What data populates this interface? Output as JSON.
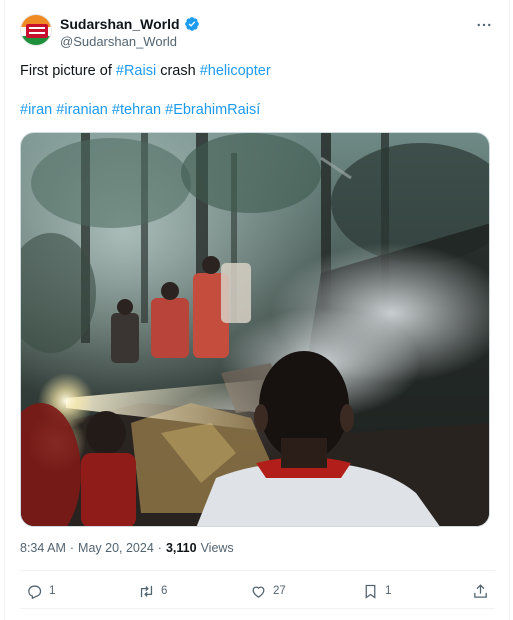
{
  "tweet": {
    "display_name": "Sudarshan_World",
    "handle": "@Sudarshan_World",
    "avatar_text": "SUDARSHAN WORLD",
    "text_intro": "First picture of",
    "hashtag_raisi": "#Raisi",
    "text_mid": "crash",
    "hashtag_helicopter": "#helicopter",
    "hashtags": [
      "#iran",
      "#iranian",
      "#tehran",
      "#EbrahimRaisí"
    ],
    "time": "8:34 AM",
    "sep1": "·",
    "date": "May 20, 2024",
    "sep2": "·",
    "views_count": "3,110",
    "views_label": "Views"
  },
  "actions": {
    "replies": "1",
    "reposts": "6",
    "likes": "27",
    "bookmarks": "1"
  },
  "icons": {
    "verified": "verified-badge-icon",
    "more": "more-options-icon",
    "reply": "reply-icon",
    "repost": "repost-icon",
    "like": "heart-icon",
    "bookmark": "bookmark-icon",
    "share": "share-icon"
  },
  "colors": {
    "link": "#1d9bf0",
    "secondary_text": "#536471",
    "primary_text": "#0f1419",
    "verified": "#1d9bf0"
  }
}
